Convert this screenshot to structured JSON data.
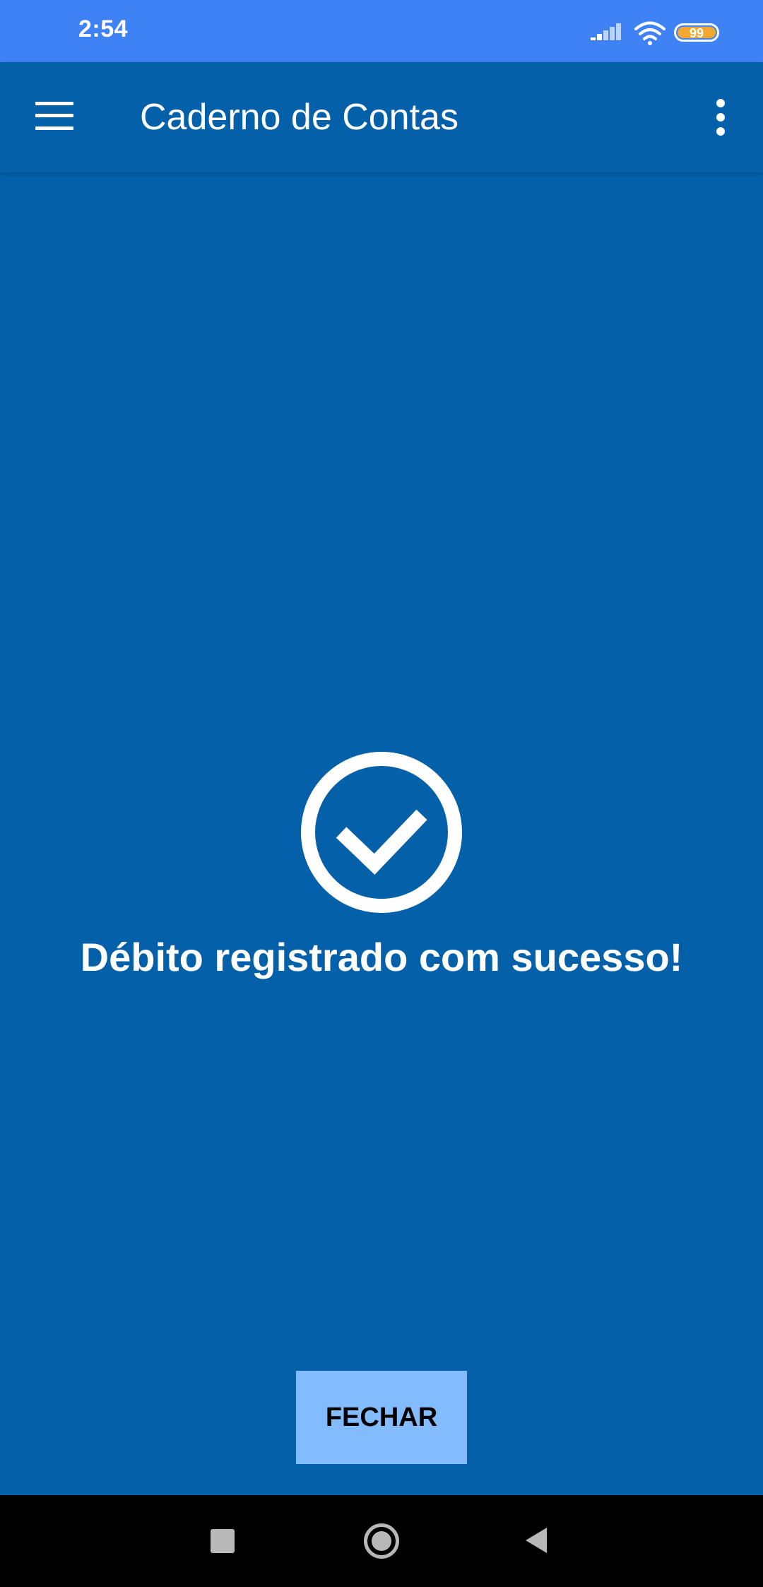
{
  "status_bar": {
    "time": "2:54",
    "battery_level": "99",
    "icons": [
      "signal-icon",
      "wifi-icon",
      "battery-icon"
    ]
  },
  "app_bar": {
    "title": "Caderno de Contas",
    "left_icon": "menu-icon",
    "right_icon": "more-vert-icon"
  },
  "main": {
    "icon": "check-circle-icon",
    "message": "Débito registrado com sucesso!",
    "close_label": "FECHAR"
  },
  "nav_bar": {
    "icons": [
      "recents-icon",
      "home-icon",
      "back-icon"
    ]
  },
  "colors": {
    "status_bar": "#3f82f5",
    "primary": "#0460a8",
    "button": "#82bcff",
    "battery": "#f0a830"
  }
}
